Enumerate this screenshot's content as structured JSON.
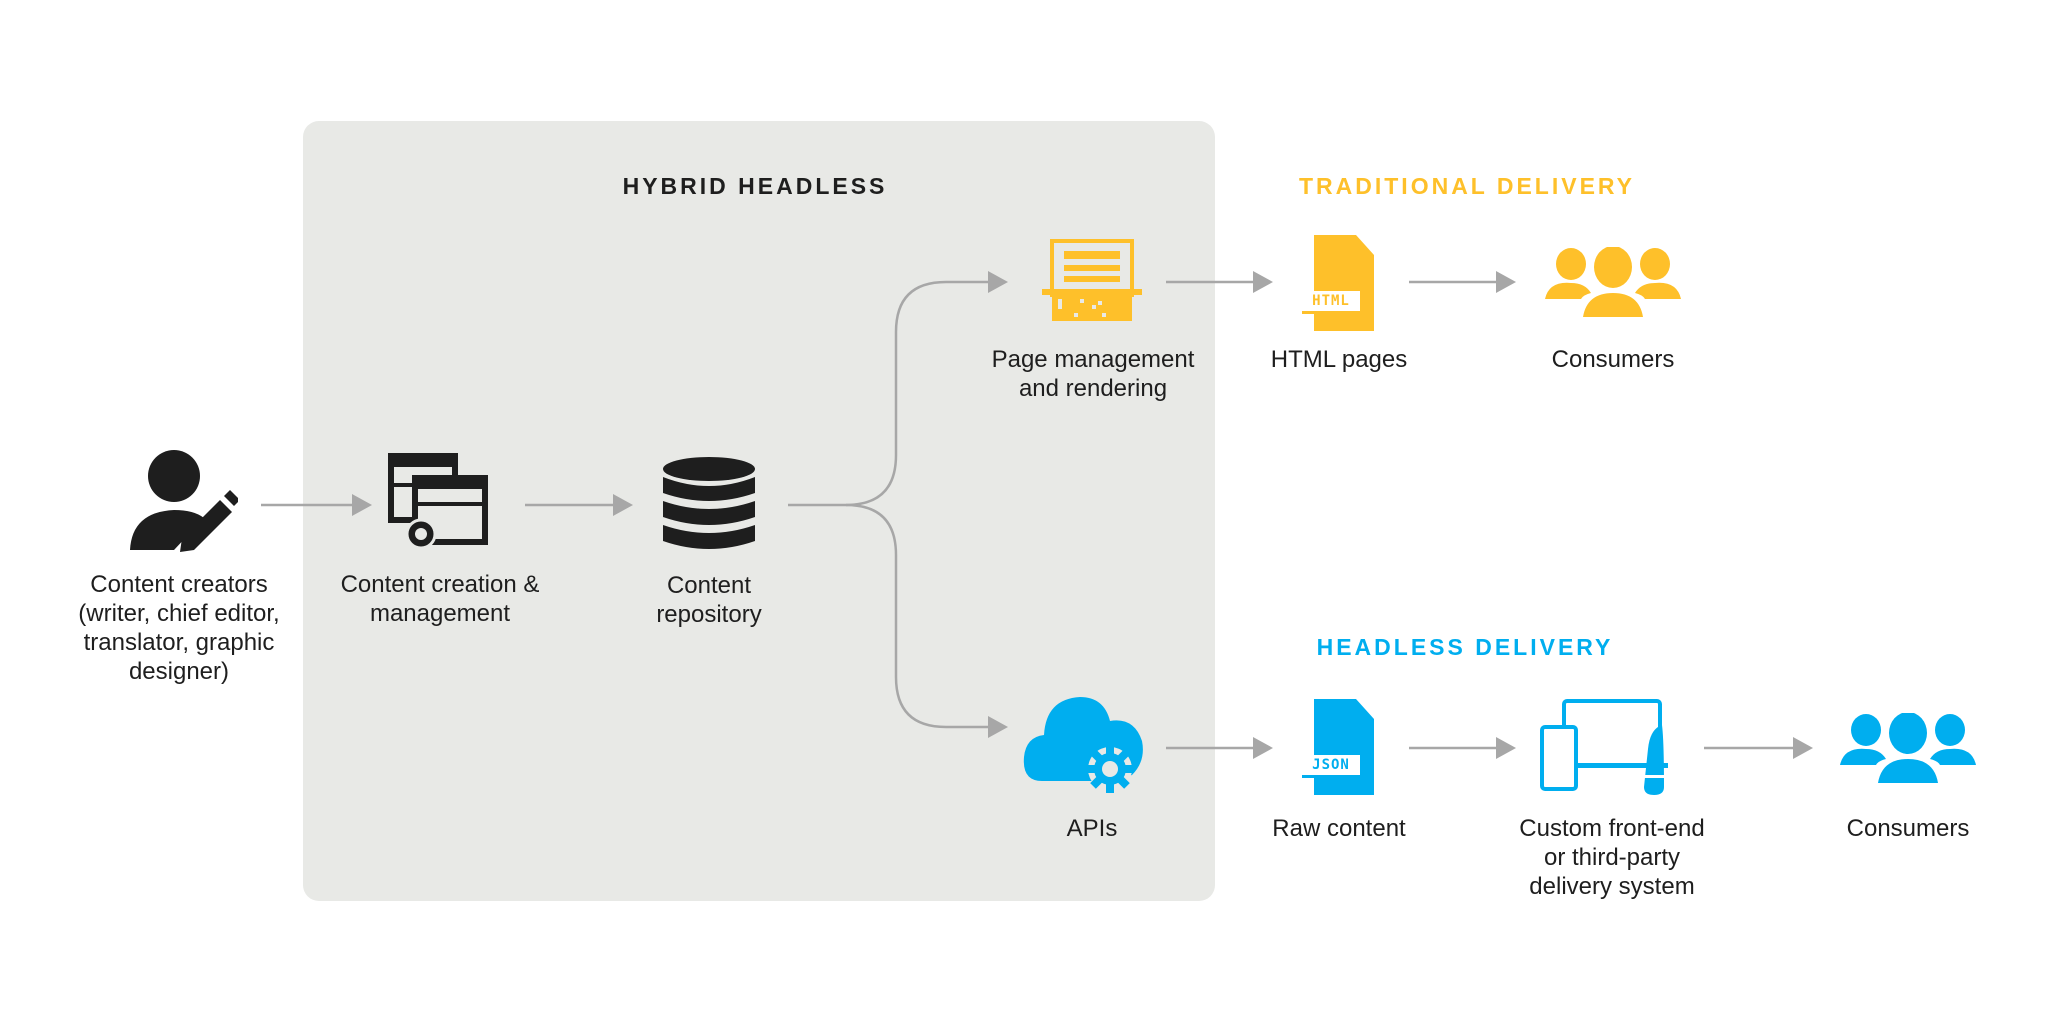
{
  "colors": {
    "traditional": "#fec02a",
    "headless": "#00aeef",
    "dark": "#1e1e1e",
    "panel": "#e8e9e6",
    "arrow": "#a7a7a7"
  },
  "sections": {
    "hybrid": "HYBRID HEADLESS",
    "traditional": "TRADITIONAL DELIVERY",
    "headless": "HEADLESS DELIVERY"
  },
  "nodes": {
    "creators": {
      "icon": "person-pencil-icon",
      "lines": [
        "Content creators",
        "(writer, chief editor,",
        "translator, graphic",
        "designer)"
      ]
    },
    "creation": {
      "icon": "windows-gear-icon",
      "lines": [
        "Content creation &",
        "management"
      ]
    },
    "repository": {
      "icon": "database-icon",
      "lines": [
        "Content",
        "repository"
      ]
    },
    "page_management": {
      "icon": "page-rendering-icon",
      "lines": [
        "Page management",
        "and rendering"
      ]
    },
    "html_pages": {
      "icon": "html-file-icon",
      "badge": "HTML",
      "lines": [
        "HTML pages"
      ]
    },
    "consumers_traditional": {
      "icon": "users-icon",
      "lines": [
        "Consumers"
      ]
    },
    "apis": {
      "icon": "cloud-gear-icon",
      "lines": [
        "APIs"
      ]
    },
    "raw_content": {
      "icon": "json-file-icon",
      "badge": "JSON",
      "lines": [
        "Raw content"
      ]
    },
    "delivery_system": {
      "icon": "devices-icon",
      "lines": [
        "Custom front-end",
        "or third-party",
        "delivery system"
      ]
    },
    "consumers_headless": {
      "icon": "users-icon",
      "lines": [
        "Consumers"
      ]
    }
  }
}
